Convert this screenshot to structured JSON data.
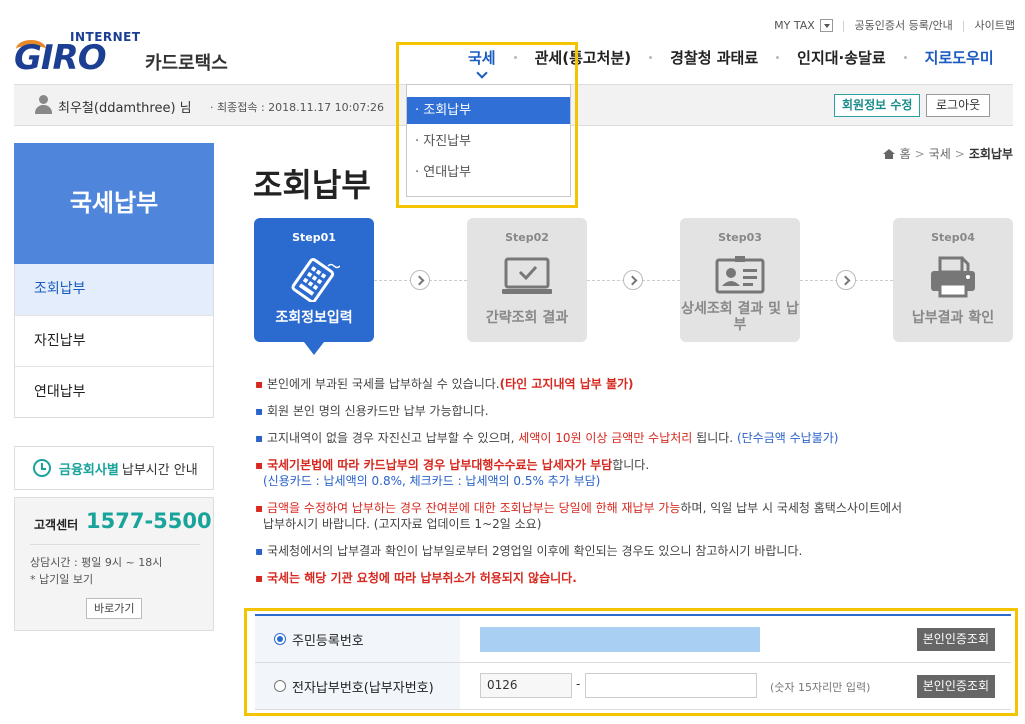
{
  "util": {
    "mytax": "MY TAX",
    "cert": "공동인증서 등록/안내",
    "sitemap": "사이트맵"
  },
  "logo": {
    "internet": "INTERNET",
    "giro": "GIRO",
    "card": "카드로택스"
  },
  "gnb": {
    "items": [
      "국세",
      "관세(통고처분)",
      "경찰청 과태료",
      "인지대·송달료",
      "지로도우미"
    ]
  },
  "dropdown": {
    "options": [
      "· 조회납부",
      "· 자진납부",
      "· 연대납부"
    ],
    "selected": "· 조회납부"
  },
  "user": {
    "name": "최우철(ddamthree) 님",
    "last_login": "· 최종접속 : 2018.11.17 10:07:26",
    "edit_label": "회원정보 수정",
    "logout_label": "로그아웃"
  },
  "sidebar": {
    "title": "국세납부",
    "items": [
      "조회납부",
      "자진납부",
      "연대납부"
    ],
    "time_label_teal": "금융회사별",
    "time_label": "납부시간 안내",
    "cs_label": "고객센터",
    "cs_number": "1577-5500",
    "hours": "상담시간 : 평일 9시 ~ 18시",
    "holiday": "* 납기일 보기",
    "go": "바로가기"
  },
  "breadcrumb": [
    "홈",
    "국세",
    "조회납부"
  ],
  "page_title": "조회납부",
  "steps": [
    {
      "num": "Step01",
      "label": "조회정보입력"
    },
    {
      "num": "Step02",
      "label": "간략조회 결과"
    },
    {
      "num": "Step03",
      "label": "상세조회 결과 및 납부"
    },
    {
      "num": "Step04",
      "label": "납부결과 확인"
    }
  ],
  "notices": {
    "n1a": "본인에게 부과된 국세를 납부하실 수 있습니다.",
    "n1b": "(타인 고지내역 납부 불가)",
    "n2": "회원 본인 명의 신용카드만 납부 가능합니다.",
    "n3a": "고지내역이 없을 경우 자진신고 납부할 수 있으며, ",
    "n3b": "세액이 10원 이상 금액만 수납처리",
    "n3c": " 됩니다. ",
    "n3d": "(단수금액 수납불가)",
    "n4a": "국세기본법에 따라 카드납부의 경우 납부대행수수료는 납세자가 부담",
    "n4b": "합니다.",
    "n4c": "(신용카드 : 납세액의 0.8%, 체크카드 : 납세액의 0.5% 추가 부담)",
    "n5a": "금액을 수정하여 납부하는 경우 잔여분에 대한 조회납부는 당일에 한해 재납부 가능",
    "n5b": "하며, 익일 납부 시 국세청 홈택스사이트에서",
    "n5c": "납부하시기 바랍니다. (고지자료 업데이트 1~2일 소요)",
    "n6": "국세청에서의 납부결과 확인이 납부일로부터 2영업일 이후에 확인되는 경우도 있으니 참고하시기 바랍니다.",
    "n7": "국세는 해당 기관 요청에 따라 납부취소가 허용되지 않습니다."
  },
  "form": {
    "row1_label": "주민등록번호",
    "row2_label": "전자납부번호(납부자번호)",
    "prefix_value": "0126",
    "dash": "-",
    "hint": "(숫자 15자리만 입력)",
    "verify_label": "본인인증조회"
  },
  "colors": {
    "primary": "#2b6bd0",
    "teal": "#18a39b",
    "highlight": "#f5c400",
    "red": "#d6281f"
  }
}
